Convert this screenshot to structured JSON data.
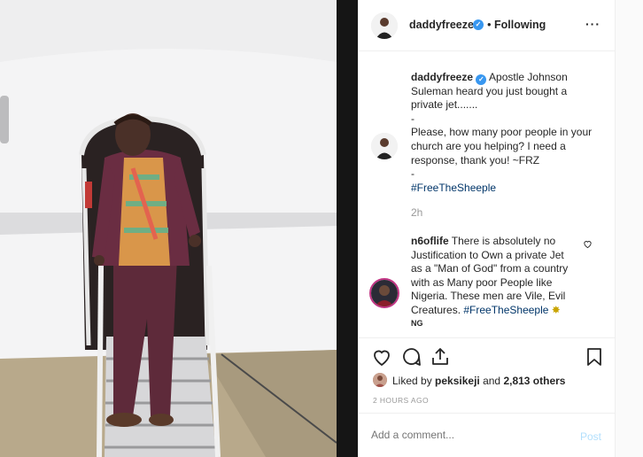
{
  "post": {
    "username": "daddyfreeze",
    "follow_separator": "•",
    "follow_status": "Following",
    "more_label": "···"
  },
  "caption": {
    "username": "daddyfreeze",
    "lines": [
      "Apostle Johnson",
      "Suleman heard you just bought a",
      "private jet.......",
      "-",
      "Please, how many poor people in your",
      "church are you helping? I need a",
      "response, thank you! ~FRZ",
      "-"
    ],
    "hashtag": "#FreeTheSheeple",
    "time": "2h"
  },
  "comment": {
    "username": "n6oflife",
    "lines": [
      "There is absolutely no",
      "Justification to Own a private Jet",
      "as a \"Man of God\" from a country",
      "with as Many poor People like",
      "Nigeria. These men are Vile, Evil"
    ],
    "last_line_prefix": "Creatures. ",
    "hashtag": "#FreeTheSheeple",
    "emoji": "✸",
    "meta": "NG"
  },
  "likes": {
    "prefix": "Liked by ",
    "user": "peksikeji",
    "middle": " and ",
    "count": "2,813 others"
  },
  "timestamp": "2 HOURS AGO",
  "add_comment": {
    "placeholder": "Add a comment...",
    "post_label": "Post"
  },
  "colors": {
    "link": "#003569",
    "verified": "#3897f0",
    "post_disabled": "#b2dffc",
    "muted": "#999999"
  }
}
